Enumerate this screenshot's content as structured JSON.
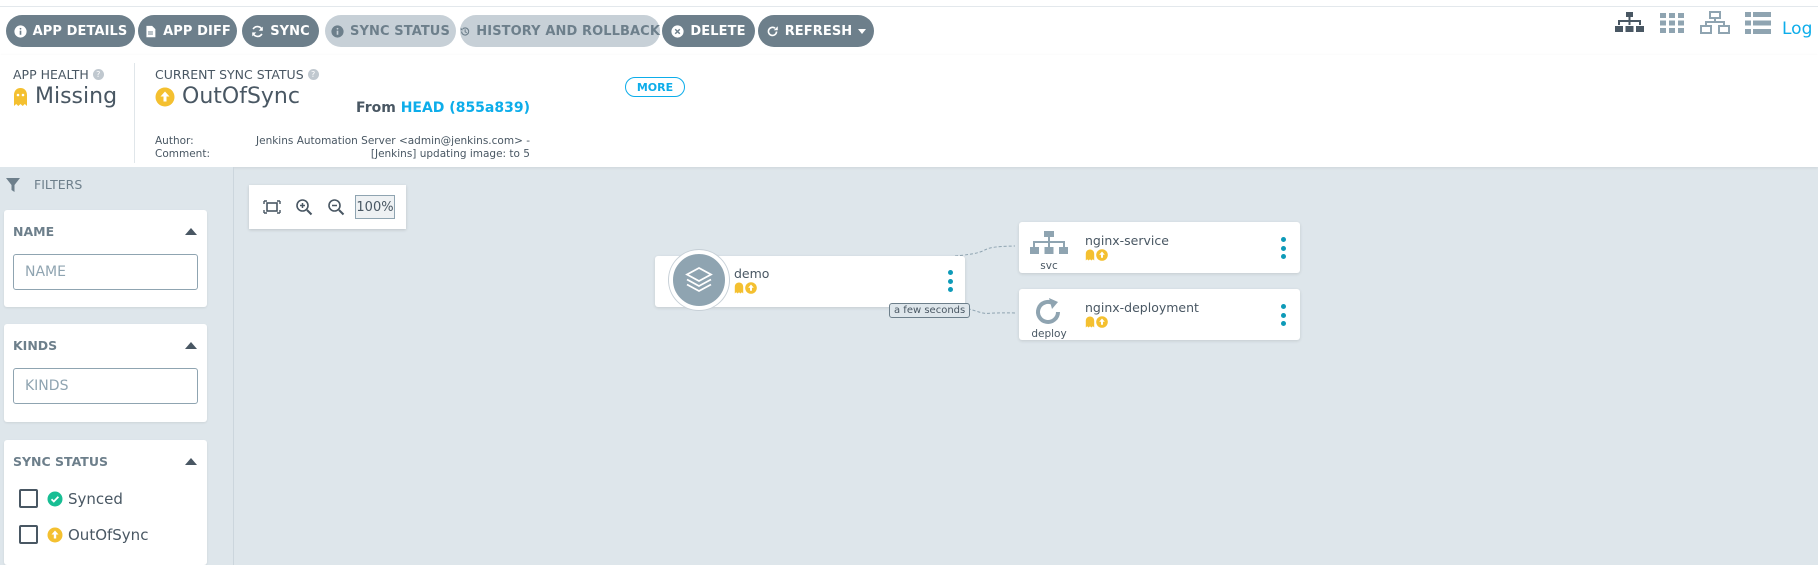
{
  "toolbar": {
    "buttons": [
      {
        "label": "APP DETAILS",
        "icon": "info-circle-icon"
      },
      {
        "label": "APP DIFF",
        "icon": "file-icon"
      },
      {
        "label": "SYNC",
        "icon": "sync-icon"
      },
      {
        "label": "SYNC STATUS",
        "icon": "info-circle-icon"
      },
      {
        "label": "HISTORY AND ROLLBACK",
        "icon": "history-icon"
      },
      {
        "label": "DELETE",
        "icon": "times-circle-icon"
      },
      {
        "label": "REFRESH",
        "icon": "redo-icon"
      }
    ],
    "views": [
      "tree-view-icon",
      "pods-view-icon",
      "network-view-icon",
      "list-view-icon"
    ],
    "logout_label": "Log out"
  },
  "health": {
    "label": "APP HEALTH",
    "status": "Missing",
    "color": "#f4c030"
  },
  "sync": {
    "label": "CURRENT SYNC STATUS",
    "status": "OutOfSync",
    "color": "#f4c030",
    "more_label": "MORE",
    "from_prefix": "From",
    "revision": "HEAD (855a839)",
    "author_key": "Author:",
    "author_value": "Jenkins Automation Server <admin@jenkins.com> -",
    "comment_key": "Comment:",
    "comment_value": "[Jenkins] updating image: to 5"
  },
  "filters": {
    "title": "FILTERS",
    "name": {
      "title": "NAME",
      "placeholder": "NAME"
    },
    "kinds": {
      "title": "KINDS",
      "placeholder": "KINDS"
    },
    "sync_status": {
      "title": "SYNC STATUS",
      "options": [
        {
          "label": "Synced",
          "color": "#18be94"
        },
        {
          "label": "OutOfSync",
          "color": "#f4c030"
        }
      ]
    }
  },
  "graph": {
    "zoom": "100%",
    "app_node": {
      "name": "demo",
      "icon": "layers-icon"
    },
    "age_label": "a few seconds",
    "resources": [
      {
        "name": "nginx-service",
        "kind": "svc",
        "icon": "service-icon"
      },
      {
        "name": "nginx-deployment",
        "kind": "deploy",
        "icon": "deployment-icon"
      }
    ]
  }
}
